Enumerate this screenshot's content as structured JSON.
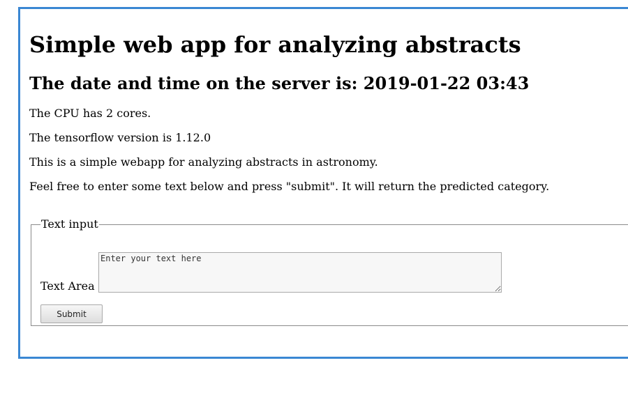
{
  "page": {
    "title": "Simple web app for analyzing abstracts",
    "server_time_heading": "The date and time on the server is: 2019-01-22 03:43",
    "paragraphs": [
      "The CPU has 2 cores.",
      "The tensorflow version is 1.12.0",
      "This is a simple webapp for analyzing abstracts in astronomy.",
      "Feel free to enter some text below and press \"submit\". It will return the predicted category."
    ]
  },
  "form": {
    "legend": "Text input",
    "textarea_label": "Text Area",
    "textarea_placeholder": "Enter your text here",
    "submit_label": "Submit"
  },
  "colors": {
    "frame_border": "#3a87d3"
  }
}
